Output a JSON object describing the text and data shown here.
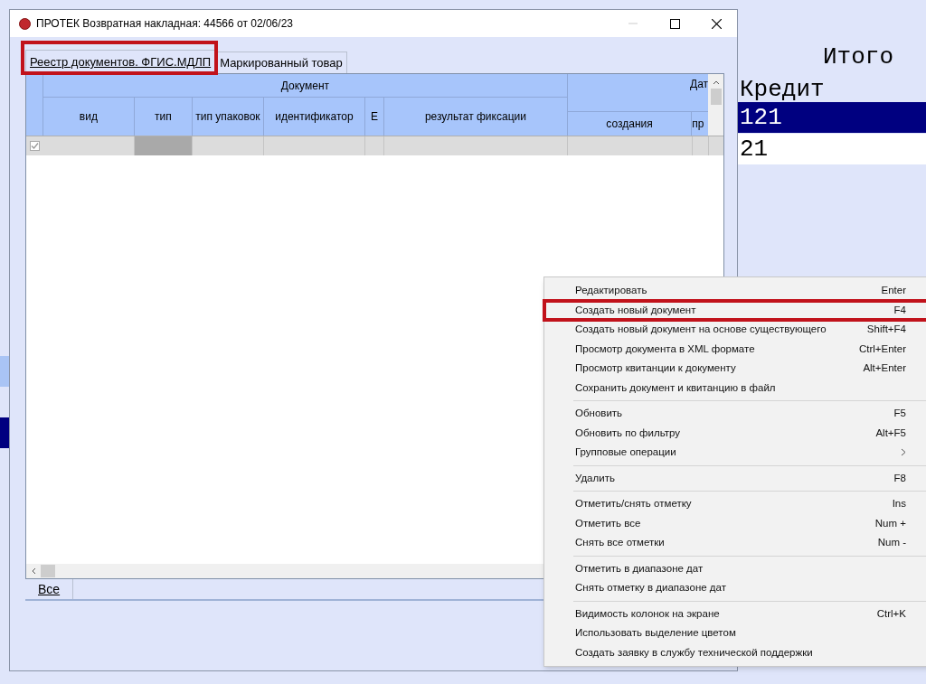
{
  "background_app": {
    "total_label": "Итого",
    "credit_label": "Кредит",
    "rows": [
      {
        "value": "121",
        "selected": true
      },
      {
        "value": "21",
        "selected": false
      }
    ]
  },
  "window": {
    "title": "ПРОТЕК Возвратная накладная: 44566 от 02/06/23",
    "tabs": [
      {
        "label": "Реестр документов. ФГИС.МДЛП",
        "selected": true
      },
      {
        "label": "Маркированный товар",
        "selected": false
      }
    ],
    "table": {
      "group_headers": [
        "Документ",
        "Дат"
      ],
      "columns": [
        "вид",
        "тип",
        "тип упаковок",
        "идентификатор",
        "Е",
        "результат фиксации",
        "создания",
        "пр"
      ],
      "rows": [
        {
          "checked": true
        }
      ]
    },
    "filter_tabs": [
      {
        "label": "Все",
        "selected": true
      }
    ]
  },
  "context_menu": {
    "items": [
      {
        "kind": "item",
        "label": "Редактировать",
        "shortcut": "Enter",
        "highlighted": false
      },
      {
        "kind": "item",
        "label": "Создать новый документ",
        "shortcut": "F4",
        "highlighted": true
      },
      {
        "kind": "item",
        "label": "Создать новый документ на основе существующего",
        "shortcut": "Shift+F4",
        "highlighted": false
      },
      {
        "kind": "item",
        "label": "Просмотр документа в XML формате",
        "shortcut": "Ctrl+Enter",
        "highlighted": false
      },
      {
        "kind": "item",
        "label": "Просмотр квитанции к документу",
        "shortcut": "Alt+Enter",
        "highlighted": false
      },
      {
        "kind": "item",
        "label": "Сохранить документ и квитанцию в файл",
        "highlighted": false
      },
      {
        "kind": "separator"
      },
      {
        "kind": "item",
        "label": "Обновить",
        "shortcut": "F5",
        "highlighted": false
      },
      {
        "kind": "item",
        "label": "Обновить по фильтру",
        "shortcut": "Alt+F5",
        "highlighted": false
      },
      {
        "kind": "submenu",
        "label": "Групповые операции",
        "highlighted": false
      },
      {
        "kind": "separator"
      },
      {
        "kind": "item",
        "label": "Удалить",
        "shortcut": "F8",
        "highlighted": false
      },
      {
        "kind": "separator"
      },
      {
        "kind": "item",
        "label": "Отметить/снять отметку",
        "shortcut": "Ins",
        "highlighted": false
      },
      {
        "kind": "item",
        "label": "Отметить все",
        "shortcut": "Num +",
        "highlighted": false
      },
      {
        "kind": "item",
        "label": "Снять все отметки",
        "shortcut": "Num -",
        "highlighted": false
      },
      {
        "kind": "separator"
      },
      {
        "kind": "item",
        "label": "Отметить в диапазоне дат",
        "highlighted": false
      },
      {
        "kind": "item",
        "label": "Снять отметку в диапазоне дат",
        "highlighted": false
      },
      {
        "kind": "separator"
      },
      {
        "kind": "item",
        "label": "Видимость колонок на экране",
        "shortcut": "Ctrl+K",
        "highlighted": false
      },
      {
        "kind": "item",
        "label": "Использовать выделение цветом",
        "highlighted": false
      },
      {
        "kind": "item",
        "label": "Создать заявку в службу технической поддержки",
        "highlighted": false
      }
    ]
  }
}
